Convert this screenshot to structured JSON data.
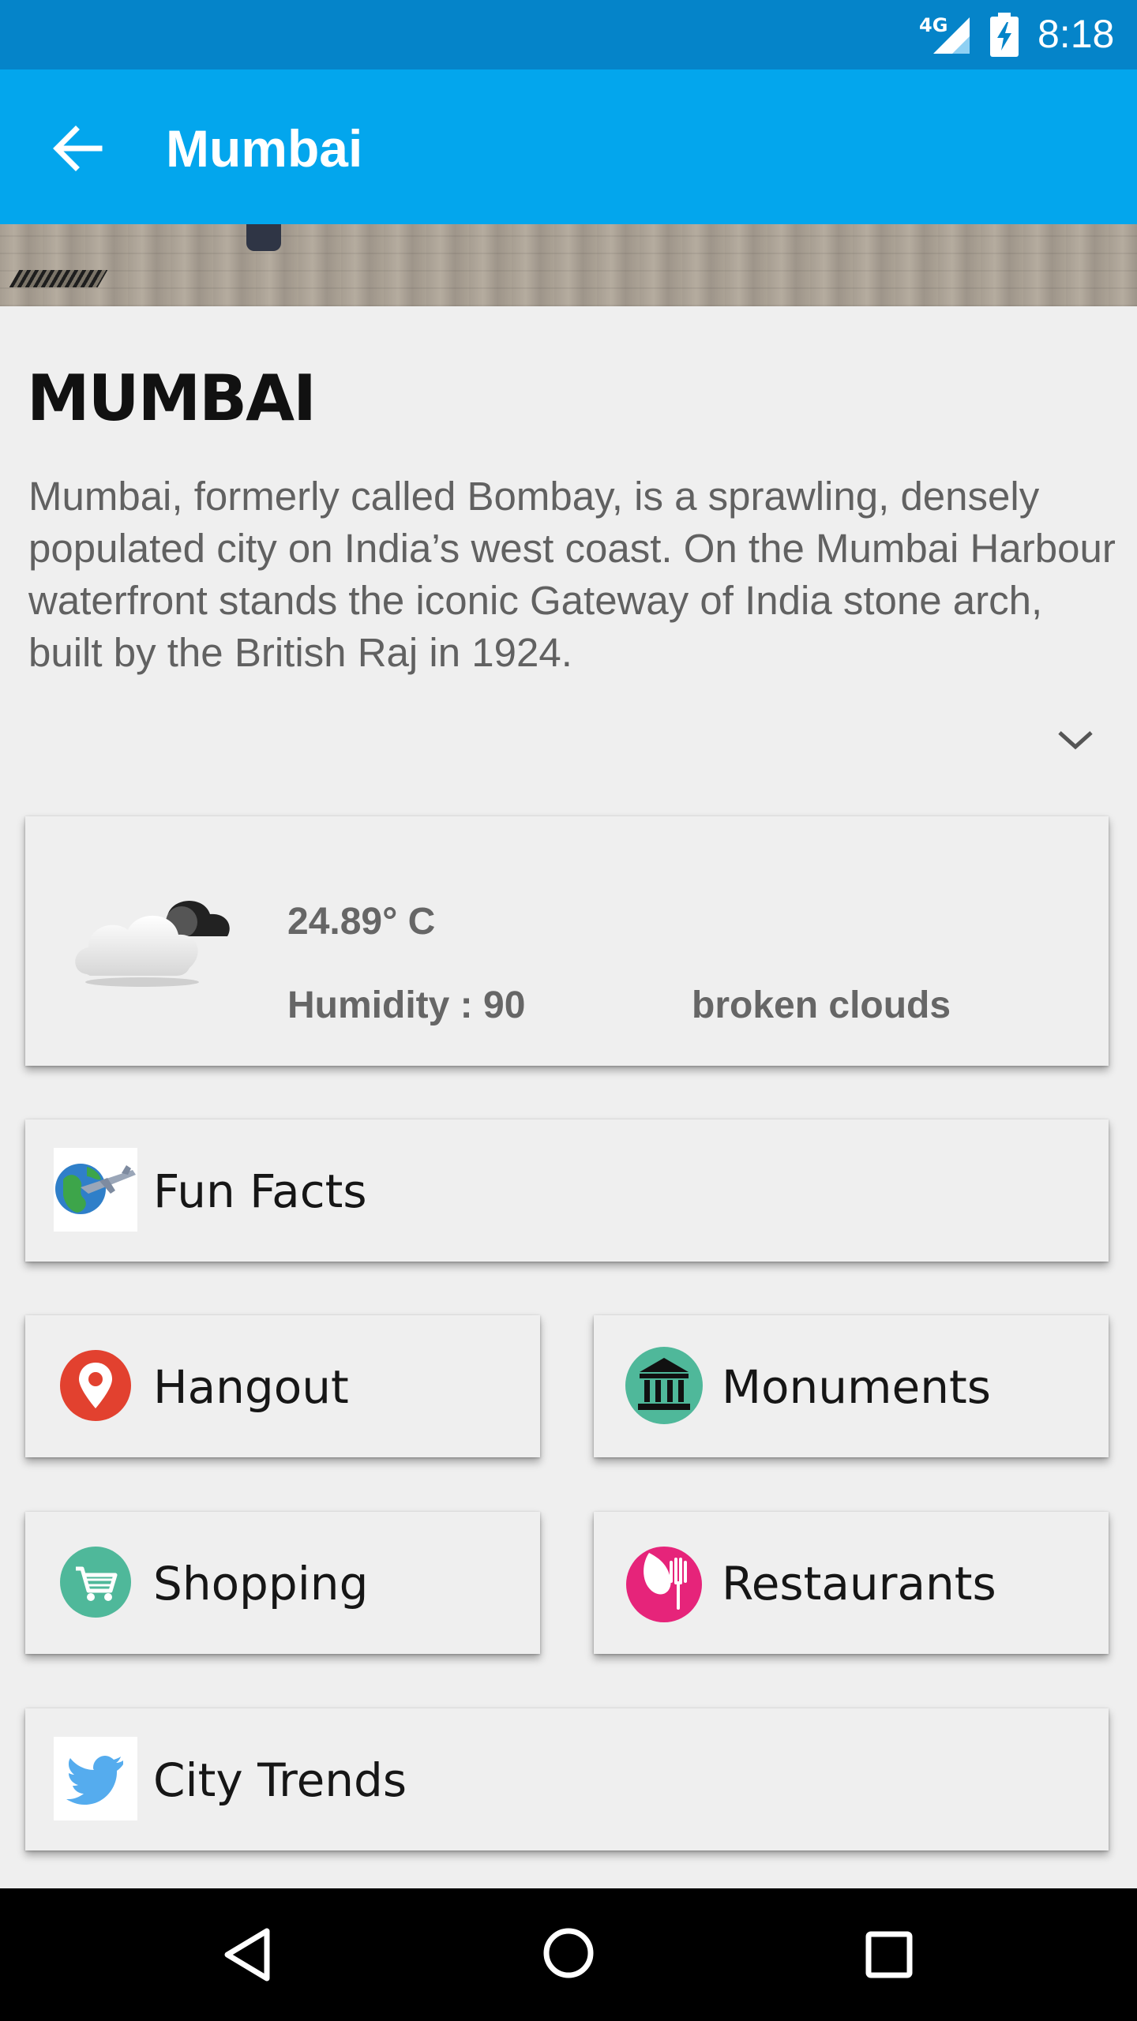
{
  "status_bar": {
    "network": "4G",
    "time": "8:18"
  },
  "app_bar": {
    "title": "Mumbai"
  },
  "city": {
    "name": "MUMBAI",
    "description": "Mumbai, formerly called Bombay, is a sprawling, densely populated city on India’s west coast. On the Mumbai Harbour waterfront stands the iconic Gateway of India stone arch, built by the British Raj in 1924."
  },
  "weather": {
    "temperature": "24.89° C",
    "humidity": "Humidity : 90",
    "condition": "broken clouds",
    "icon": "cloud-icon"
  },
  "tiles": {
    "fun_facts": {
      "label": "Fun Facts",
      "icon": "globe-plane-icon"
    },
    "hangout": {
      "label": "Hangout",
      "icon": "map-pin-icon"
    },
    "monuments": {
      "label": "Monuments",
      "icon": "museum-icon"
    },
    "shopping": {
      "label": "Shopping",
      "icon": "cart-icon"
    },
    "restaurants": {
      "label": "Restaurants",
      "icon": "restaurant-icon"
    },
    "city_trends": {
      "label": "City Trends",
      "icon": "twitter-bird-icon"
    }
  },
  "colors": {
    "status_bar": "#0584c9",
    "app_bar": "#03a6ed",
    "hangout_icon": "#e2412f",
    "monuments_icon": "#4fb89a",
    "shopping_icon": "#4fb89a",
    "restaurants_icon": "#e6247a",
    "twitter_icon": "#55acee"
  }
}
